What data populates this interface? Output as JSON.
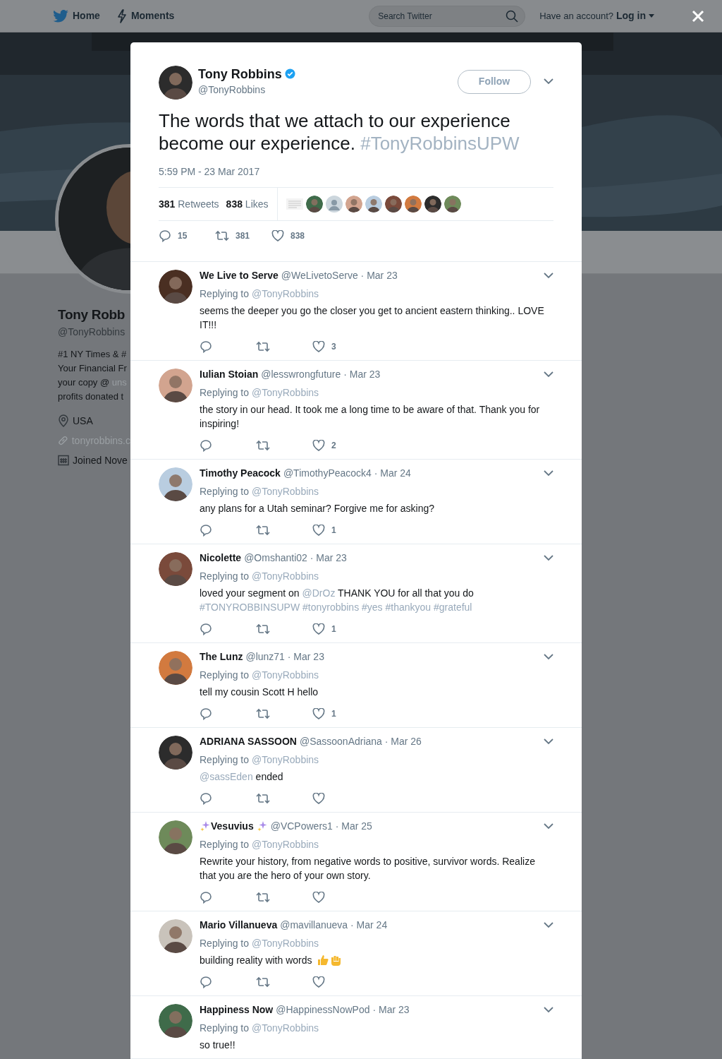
{
  "nav": {
    "items": [
      {
        "label": "Home",
        "kind": "bird"
      },
      {
        "label": "Moments",
        "kind": "bolt"
      }
    ],
    "search": {
      "placeholder": "Search Twitter"
    },
    "account_prompt": "Have an account?",
    "login": "Log in"
  },
  "banner": {
    "kind": "picture"
  },
  "profile": {
    "name": "Tony Robb",
    "handle": "@TonyRobbins",
    "bio_lines": [
      {
        "text": "#1 NY Times & #"
      },
      {
        "text": "Your Financial Fr"
      },
      {
        "text": "your copy @ ",
        "link": "uns"
      },
      {
        "text": "profits donated t"
      }
    ],
    "details": [
      {
        "kind": "location",
        "text": "USA",
        "link": false
      },
      {
        "kind": "website",
        "text": "tonyrobbins.c",
        "link": true
      },
      {
        "kind": "joined",
        "text": "Joined Nove",
        "link": false
      }
    ]
  },
  "tweet": {
    "name": "Tony Robbins",
    "verified": true,
    "handle": "@TonyRobbins",
    "follow": "Follow",
    "text": "The words that we attach to our experience become our experience.",
    "hashtag": "#TonyRobbinsUPW",
    "time": "5:59 PM - 23 Mar 2017",
    "retweets": {
      "count": "381",
      "label": "Retweets"
    },
    "likes": {
      "count": "838",
      "label": "Likes"
    },
    "likers": [
      {
        "kind": "note"
      },
      {
        "kind": "picture"
      },
      {
        "kind": "default"
      },
      {
        "kind": "picture"
      },
      {
        "kind": "picture"
      },
      {
        "kind": "picture"
      },
      {
        "kind": "picture"
      },
      {
        "kind": "picture"
      },
      {
        "kind": "picture"
      }
    ],
    "actions": {
      "replies": "15",
      "retweets": "381",
      "likes": "838"
    }
  },
  "replies": [
    {
      "name": "We Live to Serve",
      "handle": "@WeLivetoServe",
      "separator": "·",
      "date": "Mar 23",
      "replying_label": "Replying to",
      "replying_to": "@TonyRobbins",
      "text": [
        {
          "kind": "plain",
          "text": "seems the deeper you go the closer you get to ancient eastern thinking.. LOVE IT!!!"
        }
      ],
      "likes": "3",
      "actions": true
    },
    {
      "name": "Iulian Stoian",
      "handle": "@lesswrongfuture",
      "separator": "·",
      "date": "Mar 23",
      "replying_label": "Replying to",
      "replying_to": "@TonyRobbins",
      "text": [
        {
          "kind": "plain",
          "text": "the story in our head. It took me a long time to be aware of that. Thank you for inspiring!"
        }
      ],
      "likes": "2",
      "actions": true
    },
    {
      "name": "Timothy Peacock",
      "handle": "@TimothyPeacock4",
      "separator": "·",
      "date": "Mar 24",
      "replying_label": "Replying to",
      "replying_to": "@TonyRobbins",
      "text": [
        {
          "kind": "plain",
          "text": "any plans for a Utah seminar? Forgive me for asking?"
        }
      ],
      "likes": "1",
      "actions": true
    },
    {
      "name": "Nicolette",
      "handle": "@Omshanti02",
      "separator": "·",
      "date": "Mar 23",
      "replying_label": "Replying to",
      "replying_to": "@TonyRobbins",
      "text": [
        {
          "kind": "plain",
          "text": "loved your segment on "
        },
        {
          "kind": "link",
          "text": "@DrOz"
        },
        {
          "kind": "plain",
          "text": " THANK YOU for all that you do "
        },
        {
          "kind": "link",
          "text": "#TONYROBBINSUPW #tonyrobbins #yes #thankyou #grateful"
        }
      ],
      "likes": "1",
      "actions": true
    },
    {
      "name": "The Lunz",
      "handle": "@lunz71",
      "separator": "·",
      "date": "Mar 23",
      "replying_label": "Replying to",
      "replying_to": "@TonyRobbins",
      "text": [
        {
          "kind": "plain",
          "text": "tell my cousin Scott H hello"
        }
      ],
      "likes": "1",
      "actions": true
    },
    {
      "name": "ADRIANA SASSOON",
      "handle": "@SassoonAdriana",
      "separator": "·",
      "date": "Mar 26",
      "replying_label": "Replying to",
      "replying_to": "@TonyRobbins",
      "text": [
        {
          "kind": "link",
          "text": "@sassEden"
        },
        {
          "kind": "plain",
          "text": " ended"
        }
      ],
      "actions": true
    },
    {
      "name": "Vesuvius",
      "kind": "sparkle-name",
      "handle": "@VCPowers1",
      "separator": "·",
      "date": "Mar 25",
      "replying_label": "Replying to",
      "replying_to": "@TonyRobbins",
      "text": [
        {
          "kind": "plain",
          "text": "Rewrite your history, from negative words to positive, survivor words.  Realize that you are the hero of your own story."
        }
      ],
      "actions": true
    },
    {
      "name": "Mario Villanueva",
      "handle": "@mavillanueva",
      "separator": "·",
      "date": "Mar 24",
      "replying_label": "Replying to",
      "replying_to": "@TonyRobbins",
      "text": [
        {
          "kind": "plain",
          "text": "building reality with words "
        },
        {
          "kind": "thumbs-up"
        },
        {
          "kind": "fist"
        }
      ],
      "actions": true
    },
    {
      "name": "Happiness Now",
      "handle": "@HappinessNowPod",
      "separator": "·",
      "date": "Mar 23",
      "replying_label": "Replying to",
      "replying_to": "@TonyRobbins",
      "text": [
        {
          "kind": "plain",
          "text": "so true!!"
        }
      ],
      "actions": false
    }
  ]
}
